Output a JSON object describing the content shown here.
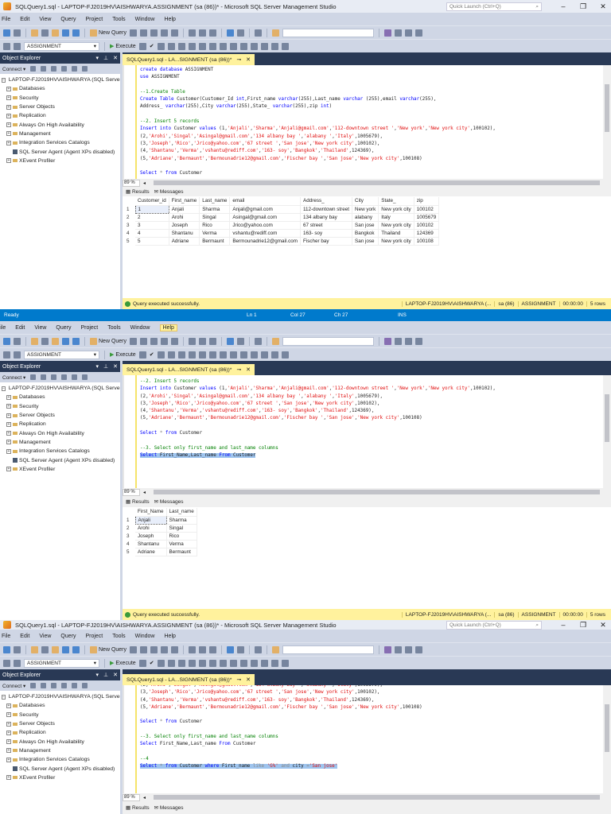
{
  "app": {
    "title": "SQLQuery1.sql - LAPTOP-FJ2019HV\\AISHWARYA.ASSIGNMENT (sa (86))* - Microsoft SQL Server Management Studio",
    "quick_launch": "Quick Launch (Ctrl+Q)",
    "menu": [
      "File",
      "Edit",
      "View",
      "Query",
      "Project",
      "Tools",
      "Window",
      "Help"
    ],
    "new_query": "New Query",
    "database": "ASSIGNMENT",
    "execute": "Execute",
    "doc_tab": "SQLQuery1.sql - LA...SIGNMENT (sa (86))*",
    "zoom": "89 %",
    "results_tab": "Results",
    "messages_tab": "Messages"
  },
  "object_explorer": {
    "title": "Object Explorer",
    "connect": "Connect",
    "server": "LAPTOP-FJ2019HV\\AISHWARYA (SQL Server",
    "nodes": [
      "Databases",
      "Security",
      "Server Objects",
      "Replication",
      "Always On High Availability",
      "Management",
      "Integration Services Catalogs",
      "SQL Server Agent (Agent XPs disabled)",
      "XEvent Profiler"
    ]
  },
  "status": {
    "message": "Query executed successfully.",
    "server": "LAPTOP-FJ2019HV\\AISHWARYA (...",
    "user": "sa (86)",
    "db": "ASSIGNMENT",
    "time": "00:00:00",
    "rows": "5 rows"
  },
  "bluebar": {
    "ready": "Ready",
    "ln": "Ln 1",
    "col": "Col 27",
    "ch": "Ch 27",
    "ins": "INS"
  },
  "panels": [
    {
      "code": [
        "create database ASSIGNMENT",
        "use ASSIGNMENT",
        "",
        "--1.Create Table",
        "Create Table Customer(Customer_Id int,First_name varchar(255),Last_name varchar (255),email varchar(255),",
        "Address_ varchar(255),City varchar(255),State_ varchar(255),zip int)",
        "",
        "--2. Insert 5 records",
        "Insert into Customer values (1,'Anjali','Sharma','Anjali@gmail.com','112-downtown street ','New york','New york city',100102),",
        "(2,'Arohi','Singal','Asingal@gmail.com','134 albany bay ','alabany ','Italy',1005679),",
        "(3,'Joseph','Rico','Jrico@yahoo.com','67 street ','San jose','New york city',100102),",
        "(4,'Shantanu','Verma','vshantu@rediff.com','163- soy','Bangkok','Thailand',124369),",
        "(5,'Adriane','Bermaunt','Bermounadrie12@gmail.com','Fischer bay ','San jose','New york city',100108)",
        "",
        "Select * from Customer"
      ],
      "selected_line": -1,
      "results": {
        "columns": [
          "Customer_id",
          "First_name",
          "Last_name",
          "email",
          "Address_",
          "City",
          "State_",
          "zip"
        ],
        "rows": [
          [
            "1",
            "Anjali",
            "Sharma",
            "Anjali@gmail.com",
            "112-downtown street",
            "New york",
            "New york city",
            "100102"
          ],
          [
            "2",
            "Arohi",
            "Singal",
            "Asingal@gmail.com",
            "134 albany bay",
            "alabany",
            "Italy",
            "1005679"
          ],
          [
            "3",
            "Joseph",
            "Rico",
            "Jrico@yahoo.com",
            "67 street",
            "San jose",
            "New york city",
            "100102"
          ],
          [
            "4",
            "Shantanu",
            "Verma",
            "vshantu@rediff.com",
            "163- soy",
            "Bangkok",
            "Thailand",
            "124369"
          ],
          [
            "5",
            "Adriane",
            "Bermaunt",
            "Bermounadrie12@gmail.com",
            "Fischer bay",
            "San jose",
            "New york city",
            "100108"
          ]
        ]
      }
    },
    {
      "code": [
        "--2. Insert 5 records",
        "Insert into Customer values (1,'Anjali','Sharma','Anjali@gmail.com','112-downtown street ','New york','New york city',100102),",
        "(2,'Arohi','Singal','Asingal@gmail.com','134 albany bay ','alabany ','Italy',1005679),",
        "(3,'Joseph','Rico','Jrico@yahoo.com','67 street ','San jose','New york city',100102),",
        "(4,'Shantanu','Verma','vshantu@rediff.com','163- soy','Bangkok','Thailand',124369),",
        "(5,'Adriane','Bermaunt','Bermounadrie12@gmail.com','Fischer bay ','San jose','New york city',100108)",
        "",
        "Select * from Customer",
        "",
        "--3. Select only first_name and last_name columns",
        "Select First_Name,Last_name From Customer"
      ],
      "selected_line": 10,
      "results": {
        "columns": [
          "First_Name",
          "Last_name"
        ],
        "rows": [
          [
            "Anjali",
            "Sharma"
          ],
          [
            "Arohi",
            "Singal"
          ],
          [
            "Joseph",
            "Rico"
          ],
          [
            "Shantanu",
            "Verma"
          ],
          [
            "Adriane",
            "Bermaunt"
          ]
        ]
      }
    },
    {
      "code": [
        "(2,'Arohi','Singal','Asingal@gmail.com','134 albany bay ','alabany ','Italy',1005679),",
        "(3,'Joseph','Rico','Jrico@yahoo.com','67 street ','San jose','New york city',100102),",
        "(4,'Shantanu','Verma','vshantu@rediff.com','163- soy','Bangkok','Thailand',124369),",
        "(5,'Adriane','Bermaunt','Bermounadrie12@gmail.com','Fischer bay ','San jose','New york city',100108)",
        "",
        "Select * from Customer",
        "",
        "--3. Select only first_name and last_name columns",
        "Select First_Name,Last_name From Customer",
        "",
        "--4",
        "Select * from Customer where First_name like 'G%' and city ='San jose'"
      ],
      "selected_line": 11
    }
  ]
}
